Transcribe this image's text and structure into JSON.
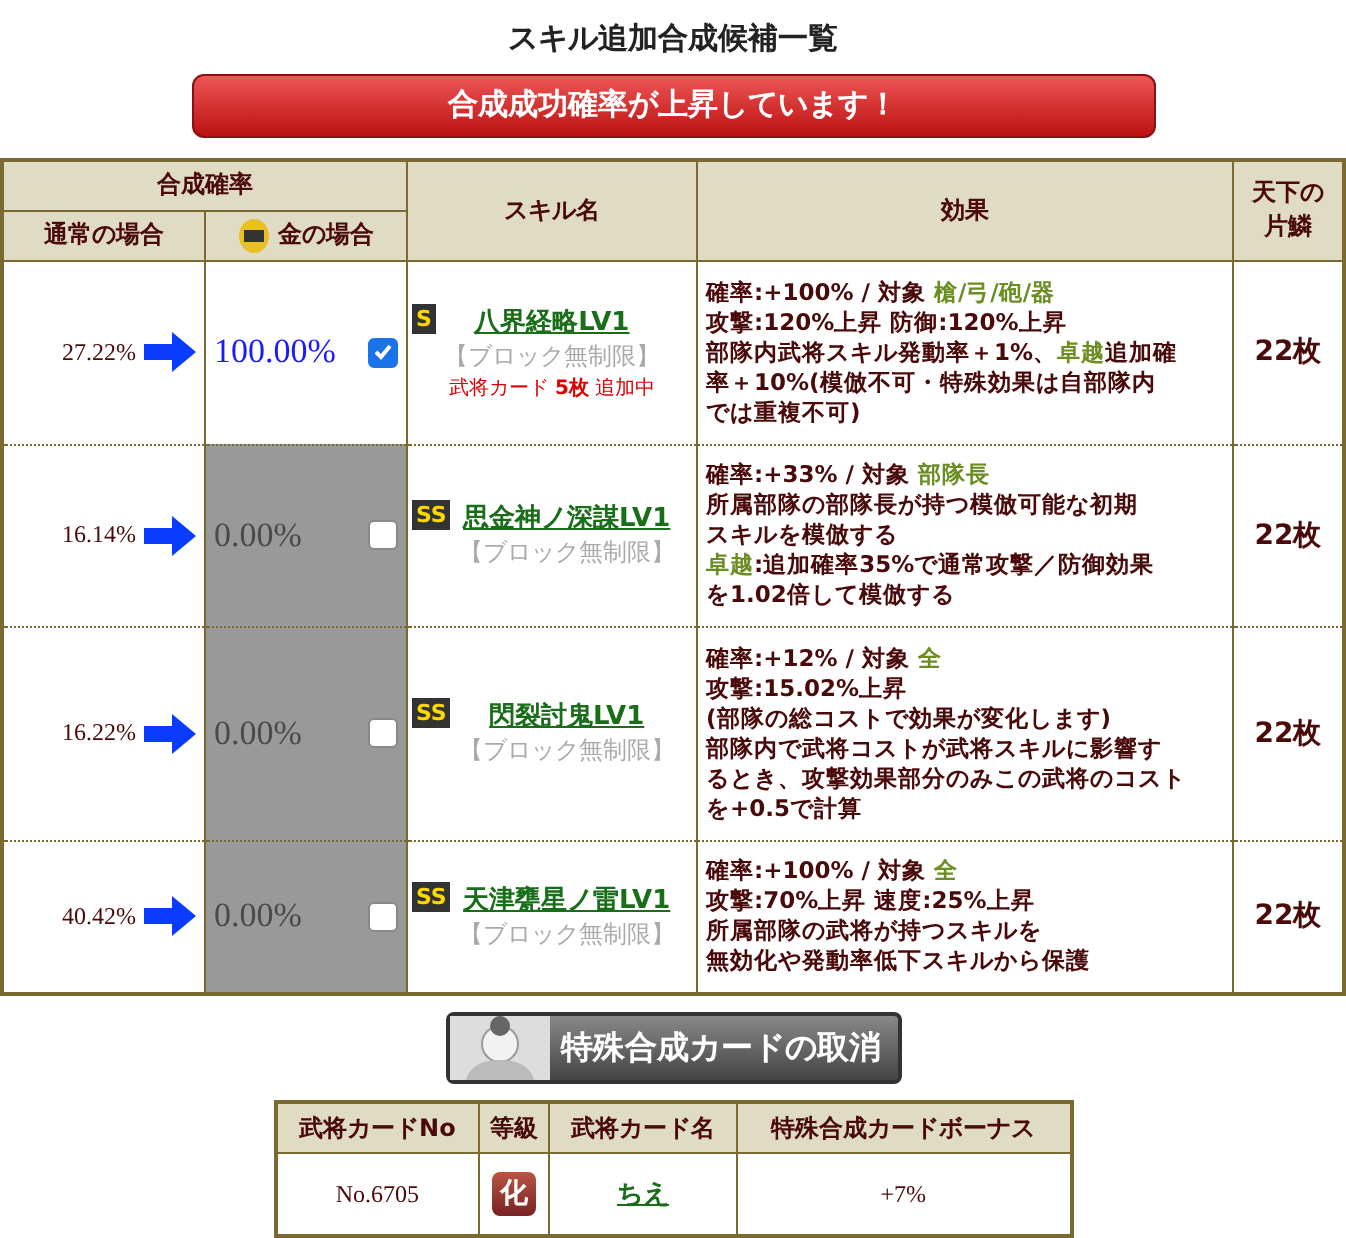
{
  "title": "スキル追加合成候補一覧",
  "banner": "合成成功確率が上昇しています！",
  "table": {
    "group_header": "合成確率",
    "columns": [
      "通常の場合",
      "金の場合",
      "スキル名",
      "効果",
      "天下の片鱗"
    ],
    "rows": [
      {
        "normal": "27.22%",
        "gold": "100.00%",
        "checked": true,
        "rank": "S",
        "skill": "八界経略LV1",
        "note": "【ブロック無制限】",
        "extra": "武将カード **5枚** 追加中",
        "effect": [
          [
            {
              "text": "確率:+100% / 対象 ",
              "highlight": false
            },
            {
              "text": "槍/弓/砲/器",
              "highlight": true
            }
          ],
          [
            {
              "text": "攻撃:120%上昇 防御:120%上昇",
              "highlight": false
            }
          ],
          [
            {
              "text": "部隊内武将スキル発動率＋1%、",
              "highlight": false
            },
            {
              "text": "卓越",
              "highlight": true
            },
            {
              "text": "追加確",
              "highlight": false
            }
          ],
          [
            {
              "text": "率＋10%(模倣不可・特殊効果は自部隊内",
              "highlight": false
            }
          ],
          [
            {
              "text": "では重複不可)",
              "highlight": false
            }
          ]
        ],
        "count": "22枚"
      },
      {
        "normal": "16.14%",
        "gold": "0.00%",
        "checked": false,
        "rank": "SS",
        "skill": "思金神ノ深謀LV1",
        "note": "【ブロック無制限】",
        "effect": [
          [
            {
              "text": "確率:+33% / 対象 ",
              "highlight": false
            },
            {
              "text": "部隊長",
              "highlight": true
            }
          ],
          [
            {
              "text": "所属部隊の部隊長が持つ模倣可能な初期",
              "highlight": false
            }
          ],
          [
            {
              "text": "スキルを模倣する",
              "highlight": false
            }
          ],
          [
            {
              "text": "卓越",
              "highlight": true
            },
            {
              "text": ":追加確率35%で通常攻撃／防御効果",
              "highlight": false
            }
          ],
          [
            {
              "text": "を1.02倍して模倣する",
              "highlight": false
            }
          ]
        ],
        "count": "22枚"
      },
      {
        "normal": "16.22%",
        "gold": "0.00%",
        "checked": false,
        "rank": "SS",
        "skill": "閃裂討鬼LV1",
        "note": "【ブロック無制限】",
        "effect": [
          [
            {
              "text": "確率:+12% / 対象 ",
              "highlight": false
            },
            {
              "text": "全",
              "highlight": true
            }
          ],
          [
            {
              "text": "攻撃:15.02%上昇",
              "highlight": false
            }
          ],
          [
            {
              "text": "(部隊の総コストで効果が変化します)",
              "highlight": false
            }
          ],
          [
            {
              "text": "部隊内で武将コストが武将スキルに影響す",
              "highlight": false
            }
          ],
          [
            {
              "text": "るとき、攻撃効果部分のみこの武将のコスト",
              "highlight": false
            }
          ],
          [
            {
              "text": "を+0.5で計算",
              "highlight": false
            }
          ]
        ],
        "count": "22枚"
      },
      {
        "normal": "40.42%",
        "gold": "0.00%",
        "checked": false,
        "rank": "SS",
        "skill": "天津甕星ノ雷LV1",
        "note": "【ブロック無制限】",
        "effect": [
          [
            {
              "text": "確率:+100% / 対象 ",
              "highlight": false
            },
            {
              "text": "全",
              "highlight": true
            }
          ],
          [
            {
              "text": "攻撃:70%上昇 速度:25%上昇",
              "highlight": false
            }
          ],
          [
            {
              "text": "所属部隊の武将が持つスキルを",
              "highlight": false
            }
          ],
          [
            {
              "text": "無効化や発動率低下スキルから保護",
              "highlight": false
            }
          ]
        ],
        "count": "22枚"
      }
    ]
  },
  "cancel_button": "特殊合成カードの取消",
  "card_table": {
    "columns": [
      "武将カードNo",
      "等級",
      "武将カード名",
      "特殊合成カードボーナス"
    ],
    "rows": [
      {
        "no": "No.6705",
        "grade": "化",
        "name": "ちえ",
        "bonus": "+7%"
      }
    ]
  }
}
